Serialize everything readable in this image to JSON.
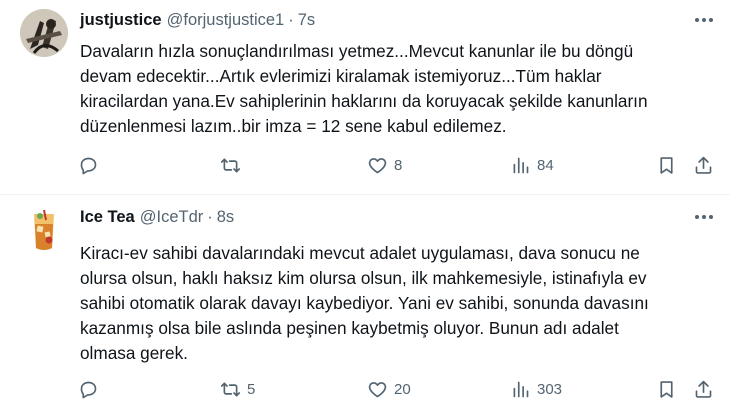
{
  "tweets": [
    {
      "name": "justjustice",
      "handle": "@forjustjustice1",
      "separator": "·",
      "time": "7s",
      "text_lines": [
        "Davaların hızla sonuçlandırılması yetmez...Mevcut kanunlar ile bu döngü",
        "devam edecektir...Artık evlerimizi kiralamak istemiyoruz...Tüm haklar",
        "kiracilardan yana.Ev sahiplerinin haklarını da koruyacak şekilde kanunların",
        "düzenlenmesi lazım..bir imza = 12 sene kabul edilemez."
      ],
      "reply_count": "",
      "retweet_count": "",
      "like_count": "8",
      "view_count": "84"
    },
    {
      "name": "Ice Tea",
      "handle": "@IceTdr",
      "separator": "·",
      "time": "8s",
      "text_lines": [
        "Kiracı-ev sahibi davalarındaki mevcut adalet uygulaması, dava sonucu ne",
        "olursa olsun, haklı haksız kim olursa olsun, ilk mahkemesiyle, istinafıyla ev",
        "sahibi otomatik olarak davayı kaybediyor. Yani ev sahibi, sonunda davasını",
        "kazanmış olsa bile aslında peşinen kaybetmiş oluyor. Bunun adı adalet",
        "olmasa gerek."
      ],
      "reply_count": "",
      "retweet_count": "5",
      "like_count": "20",
      "view_count": "303"
    }
  ],
  "icons": {
    "more": "more-horizontal-icon",
    "reply": "reply-icon",
    "retweet": "retweet-icon",
    "like": "heart-icon",
    "views": "views-chart-icon",
    "bookmark": "bookmark-icon",
    "share": "share-icon"
  },
  "colors": {
    "text_primary": "#0f1419",
    "text_secondary": "#536471",
    "divider": "#eff3f4",
    "background": "#ffffff"
  }
}
